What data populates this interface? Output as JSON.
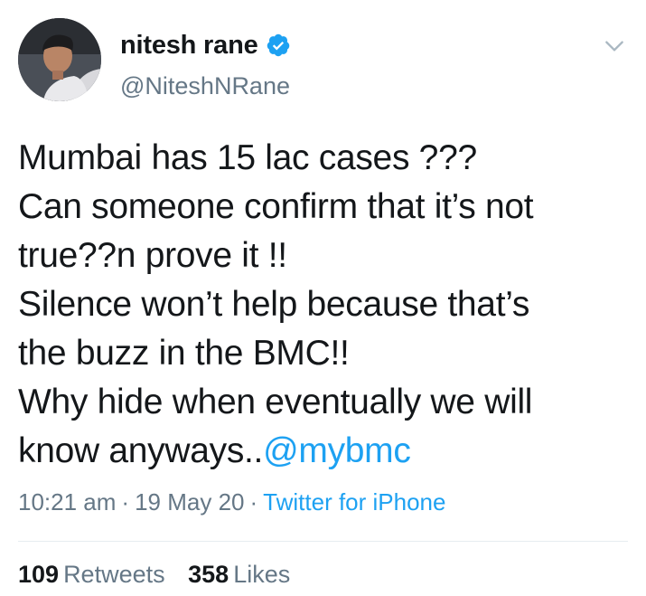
{
  "user": {
    "display_name": "nitesh rane",
    "handle": "@NiteshNRane",
    "verified": true
  },
  "tweet": {
    "lines": [
      "Mumbai has 15 lac cases ???",
      "Can someone confirm that it’s not",
      "true??n prove it !!",
      "Silence won’t help because that’s",
      "the buzz in the BMC!!",
      "Why hide when eventually we will"
    ],
    "last_line_prefix": "know anyways..",
    "mention": "@mybmc"
  },
  "meta": {
    "time": "10:21 am",
    "separator": "·",
    "date": "19 May 20",
    "source": "Twitter for iPhone"
  },
  "stats": {
    "retweets_count": "109",
    "retweets_label": "Retweets",
    "likes_count": "358",
    "likes_label": "Likes"
  },
  "colors": {
    "text": "#14171a",
    "secondary": "#657786",
    "link": "#1da1f2"
  },
  "icons": {
    "verified": "verified-badge-icon",
    "menu": "chevron-down-icon"
  }
}
